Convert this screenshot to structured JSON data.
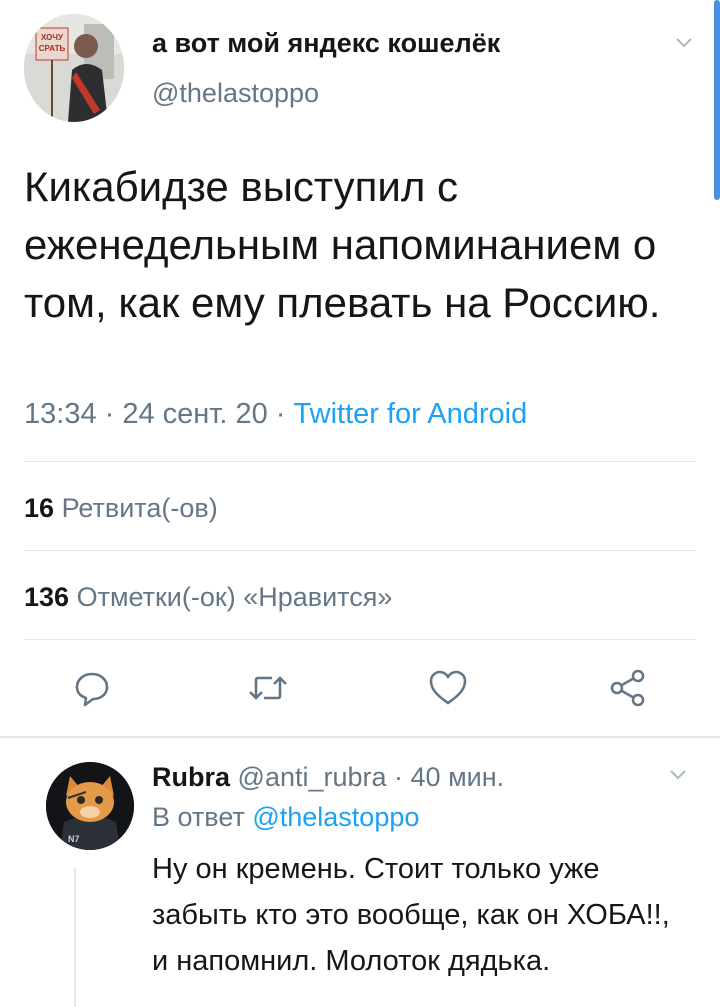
{
  "tweet": {
    "author_name": "а вот мой яндекс кошелёк",
    "author_handle": "@thelastoppo",
    "text": "Кикабидзе выступил с еженедельным напоминанием о том, как ему плевать на Россию.",
    "time": "13:34 · 24 сент. 20 ·",
    "source": "Twitter for Android",
    "retweets_count": "16",
    "retweets_label": "Ретвита(-ов)",
    "likes_count": "136",
    "likes_label": "Отметки(-ок) «Нравится»",
    "avatar_sign_text": "ХОЧУ СРАТЬ",
    "actions": [
      "reply-icon",
      "retweet-icon",
      "like-icon",
      "share-icon"
    ]
  },
  "reply": {
    "name": "Rubra",
    "handle": "@anti_rubra",
    "time": "· 40 мин.",
    "reply_to_label": "В ответ",
    "reply_to_mention": "@thelastoppo",
    "text": "Ну он кремень. Стоит только уже забыть кто это вообще, как он ХОБА!!, и напомнил. Молоток дядька.",
    "avatar_badge": "N7"
  },
  "colors": {
    "link": "#1da1f2",
    "secondary_text": "#657786",
    "primary_text": "#14171a",
    "divider": "#e1e8ed",
    "scrollbar": "#4a90e2"
  }
}
